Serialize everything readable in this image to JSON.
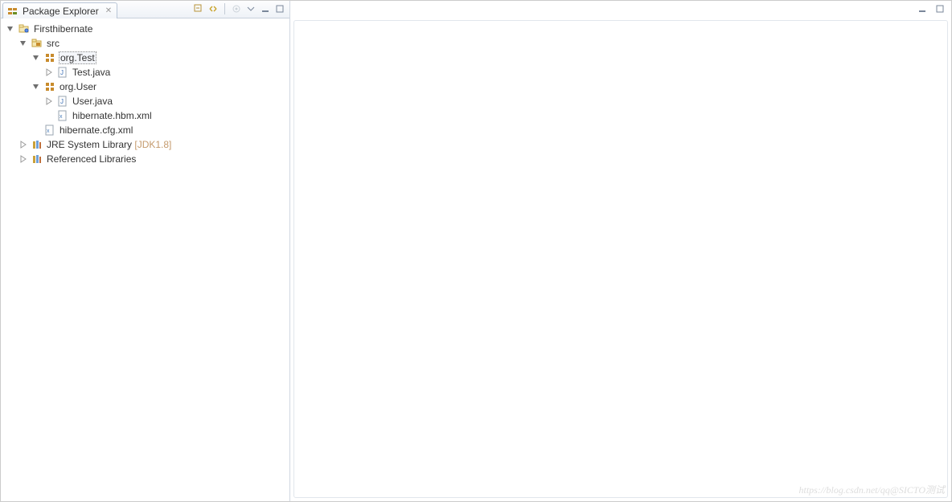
{
  "explorer": {
    "tab_title": "Package Explorer",
    "toolbar": {
      "collapse_all": "Collapse All",
      "link_editor": "Link with Editor",
      "focus_task": "Focus on Active Task",
      "view_menu": "View Menu",
      "minimize": "Minimize",
      "maximize": "Maximize"
    },
    "tree": {
      "project": {
        "label": "Firsthibernate",
        "src": {
          "label": "src",
          "packages": [
            {
              "name": "org.Test",
              "selected": true,
              "files": [
                {
                  "name": "Test.java",
                  "type": "java"
                }
              ]
            },
            {
              "name": "org.User",
              "files": [
                {
                  "name": "User.java",
                  "type": "java"
                },
                {
                  "name": "hibernate.hbm.xml",
                  "type": "xml"
                }
              ]
            }
          ],
          "root_files": [
            {
              "name": "hibernate.cfg.xml",
              "type": "xml"
            }
          ]
        },
        "jre": {
          "label": "JRE System Library",
          "suffix": "[JDK1.8]"
        },
        "ref": {
          "label": "Referenced Libraries"
        }
      }
    }
  },
  "editor": {
    "minimize": "Minimize",
    "maximize": "Maximize"
  },
  "watermark": "https://blog.csdn.net/qq@SICTO测试"
}
